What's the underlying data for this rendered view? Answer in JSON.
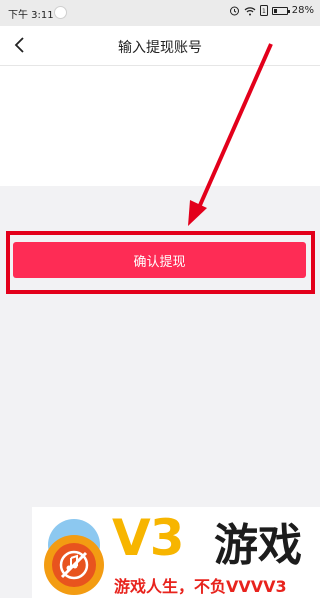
{
  "status_bar": {
    "time": "下午 3:11",
    "battery_percent": "28%",
    "battery_level": 0.28
  },
  "header": {
    "title": "输入提现账号",
    "back_icon": "chevron-left-icon"
  },
  "actions": {
    "confirm_label": "确认提现",
    "confirm_color": "#fe2c55"
  },
  "annotation": {
    "highlight_color": "#e3001b"
  },
  "watermark": {
    "brand": "V3",
    "brand_cn": "游戏",
    "slogan": "游戏人生，不负VVVV3"
  }
}
